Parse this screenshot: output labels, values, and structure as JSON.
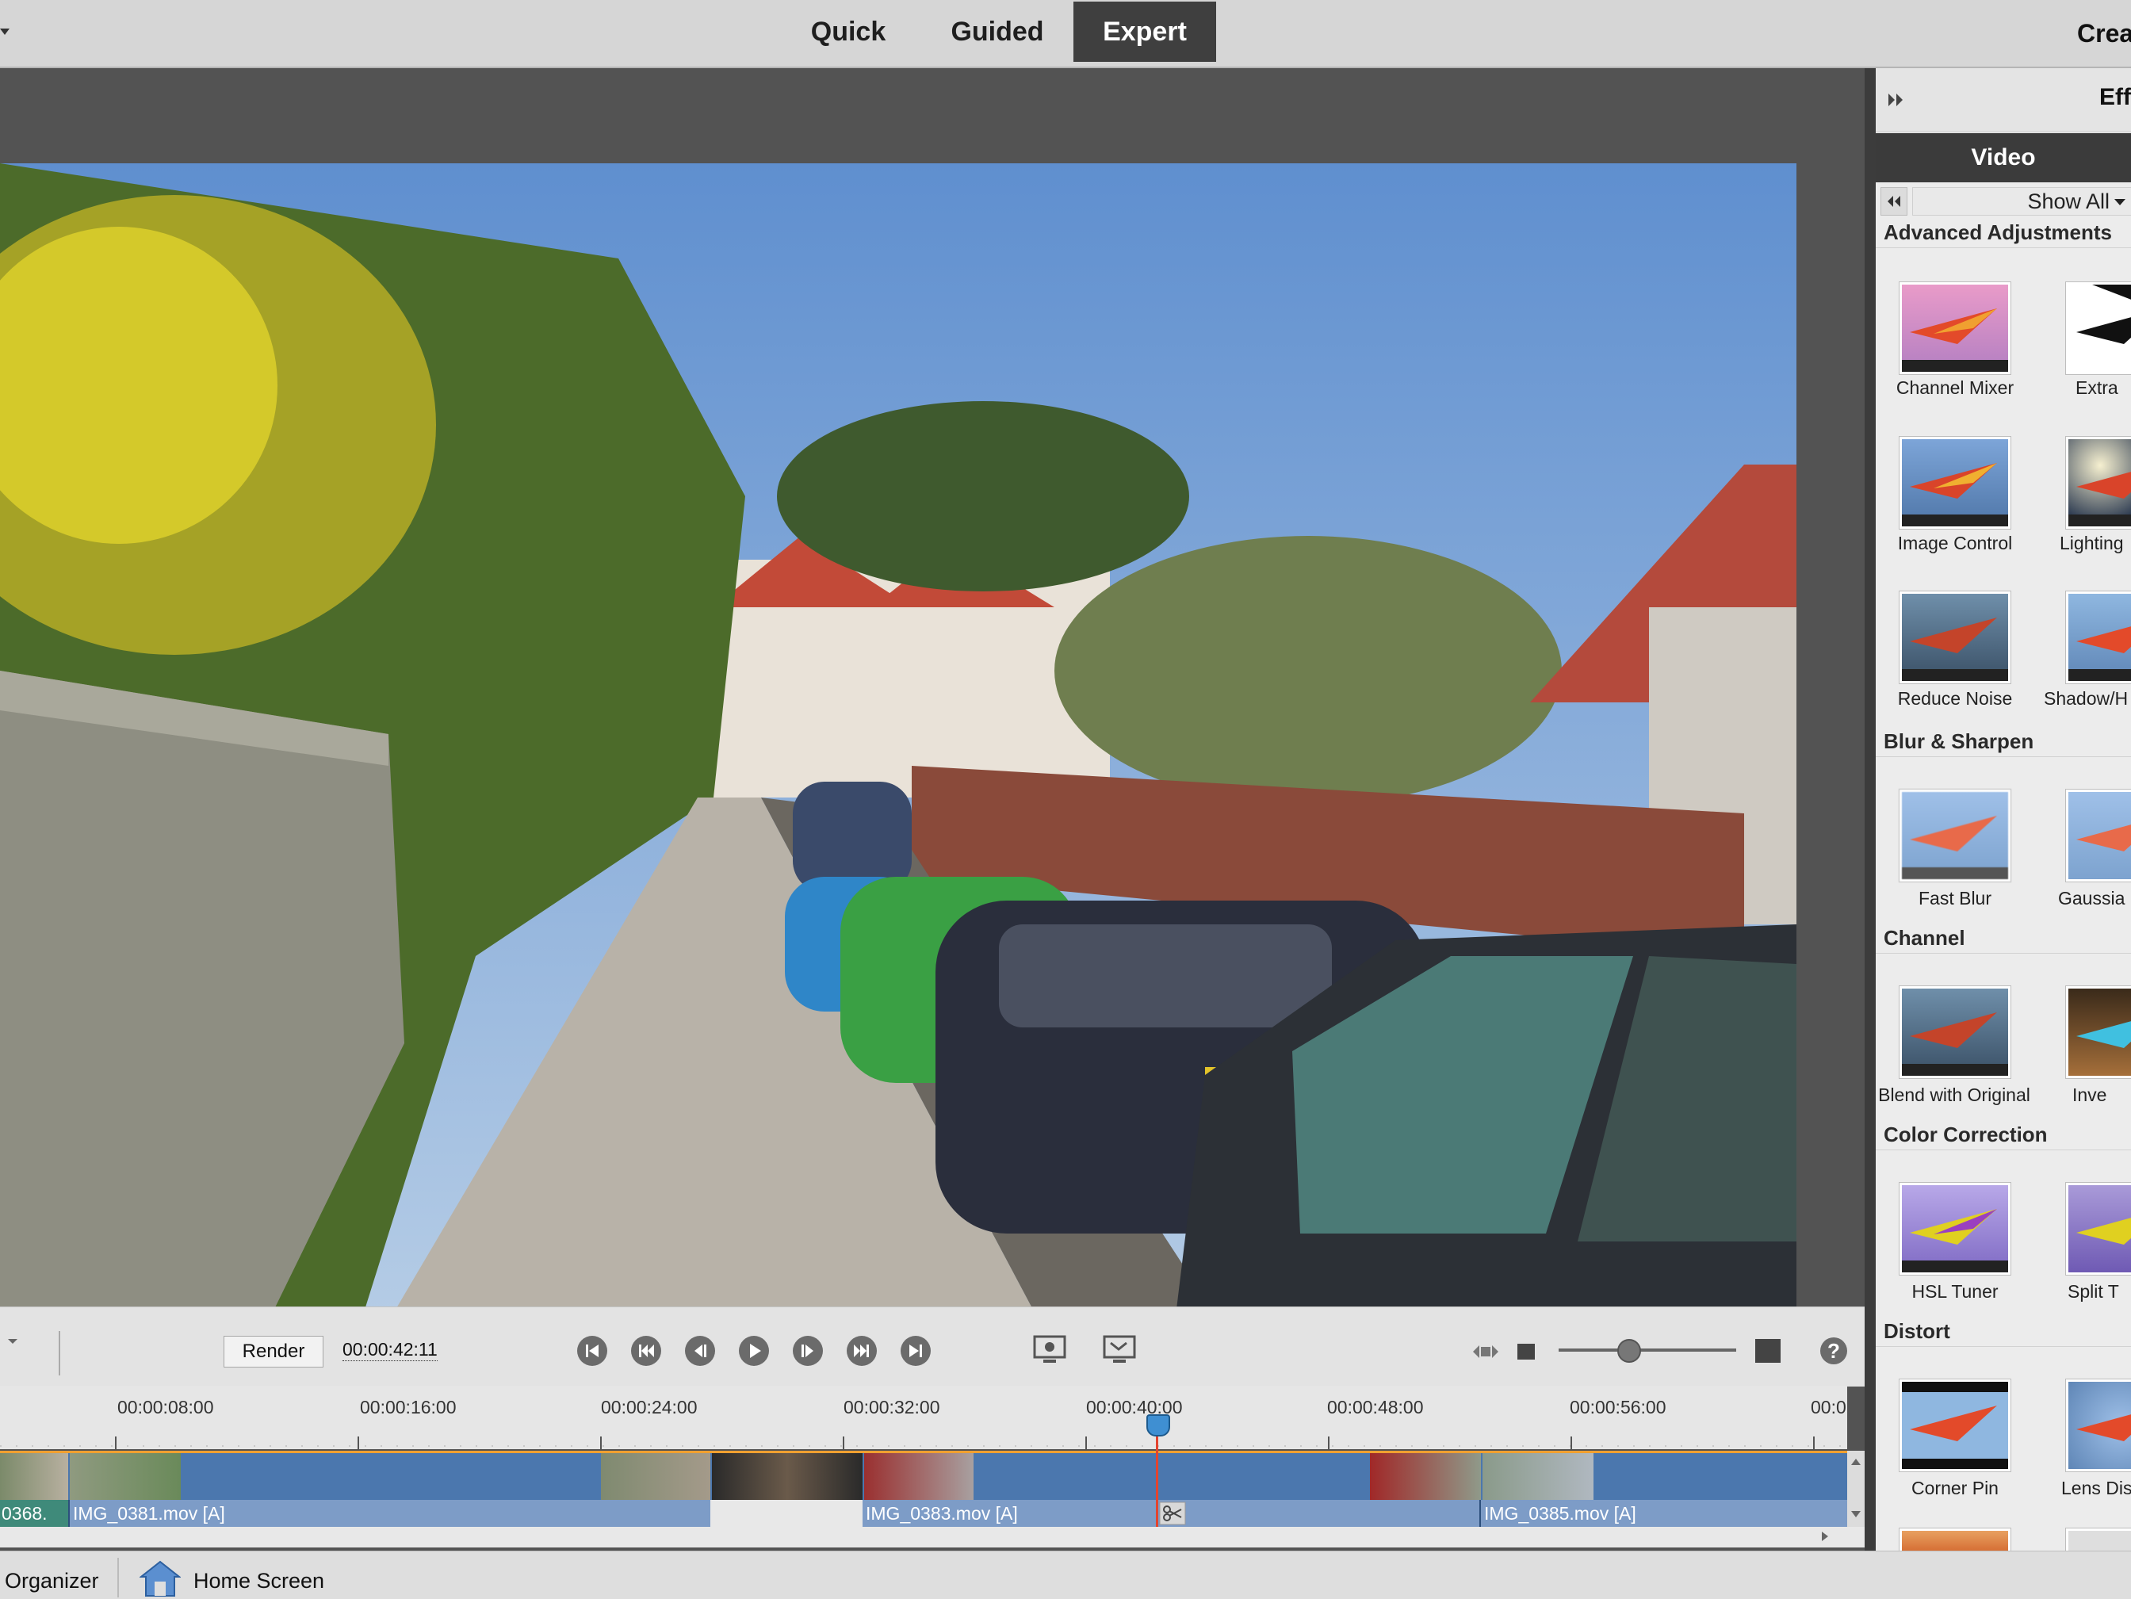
{
  "header": {
    "tabs": [
      {
        "label": "Quick",
        "active": false
      },
      {
        "label": "Guided",
        "active": false
      },
      {
        "label": "Expert",
        "active": true
      }
    ],
    "create_label": "Crea"
  },
  "panel": {
    "title": "Effe",
    "tab": "Video",
    "filter_value": "Show All",
    "categories": [
      {
        "title": "Advanced Adjustments",
        "items": [
          "Channel Mixer",
          "Extra",
          "Image Control",
          "Lighting",
          "Reduce Noise",
          "Shadow/H"
        ]
      },
      {
        "title": "Blur & Sharpen",
        "items": [
          "Fast Blur",
          "Gaussia"
        ]
      },
      {
        "title": "Channel",
        "items": [
          "Blend with Original",
          "Inve"
        ]
      },
      {
        "title": "Color Correction",
        "items": [
          "HSL Tuner",
          "Split T"
        ]
      },
      {
        "title": "Distort",
        "items": [
          "Corner Pin",
          "Lens Dist"
        ]
      }
    ]
  },
  "transport": {
    "render_label": "Render",
    "timecode": "00:00:42:11"
  },
  "timeline": {
    "ruler_labels": [
      "00:00:08:00",
      "00:00:16:00",
      "00:00:24:00",
      "00:00:32:00",
      "00:00:40:00",
      "00:00:48:00",
      "00:00:56:00",
      "00:0"
    ],
    "audio_clips": [
      "0368.",
      "IMG_0381.mov [A]",
      "IMG_0383.mov [A]",
      "IMG_0385.mov [A]"
    ]
  },
  "statusbar": {
    "organizer_label": "Organizer",
    "home_label": "Home Screen"
  },
  "colors": {
    "accent_blue": "#4b77ae",
    "playhead_red": "#e3442f",
    "active_tab": "#3f3f3f"
  }
}
